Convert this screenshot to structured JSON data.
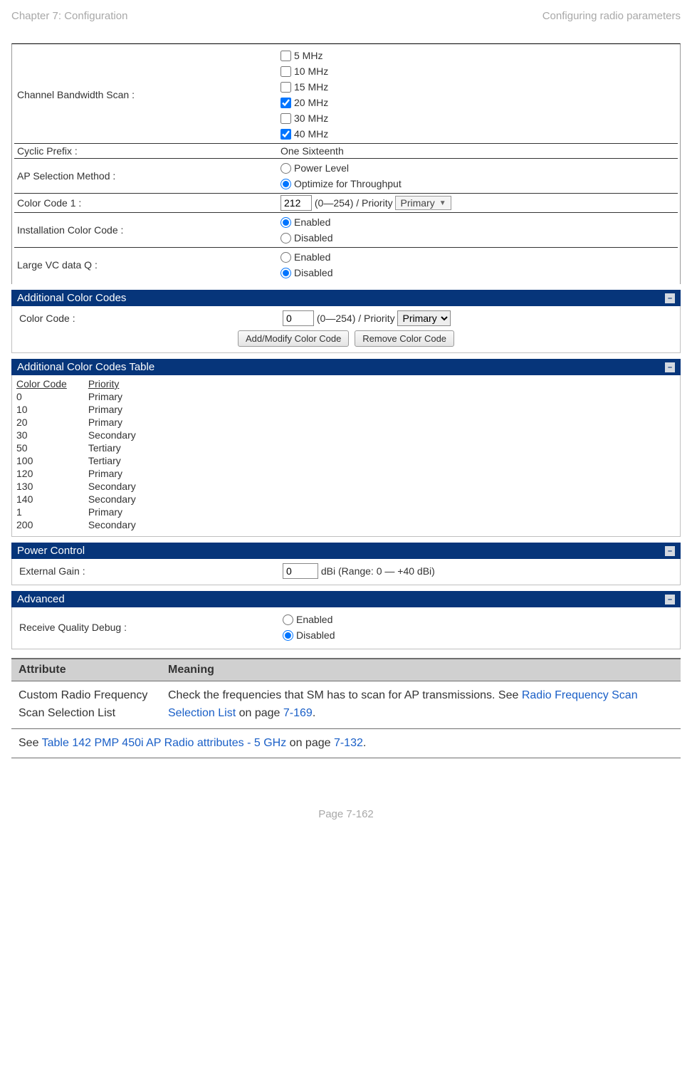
{
  "page": {
    "chapter": "Chapter 7:  Configuration",
    "section": "Configuring radio parameters",
    "footer": "Page 7-162"
  },
  "rows": {
    "channel_bw_label": "Channel Bandwidth Scan :",
    "channel_bw_opts": {
      "o0": "5 MHz",
      "o1": "10 MHz",
      "o2": "15 MHz",
      "o3": "20 MHz",
      "o4": "30 MHz",
      "o5": "40 MHz"
    },
    "cyclic_prefix_label": "Cyclic Prefix :",
    "cyclic_prefix_value": "One Sixteenth",
    "ap_sel_label": "AP Selection Method :",
    "ap_sel_opts": {
      "o0": "Power Level",
      "o1": "Optimize for Throughput"
    },
    "cc1_label": "Color Code 1 :",
    "cc1_value": "212",
    "cc1_range": "(0—254) / Priority",
    "cc1_priority": "Primary",
    "install_cc_label": "Installation Color Code :",
    "install_cc_opts": {
      "o0": "Enabled",
      "o1": "Disabled"
    },
    "large_vc_label": "Large VC data Q :",
    "large_vc_opts": {
      "o0": "Enabled",
      "o1": "Disabled"
    }
  },
  "additional_cc": {
    "header": "Additional Color Codes",
    "label": "Color Code :",
    "value": "0",
    "range": "(0—254) / Priority",
    "priority": "Primary",
    "btn_add": "Add/Modify Color Code",
    "btn_remove": "Remove Color Code"
  },
  "cc_table": {
    "header": "Additional Color Codes Table",
    "h_code": "Color Code",
    "h_priority": "Priority",
    "rows": {
      "r0": {
        "c": "0",
        "p": "Primary"
      },
      "r1": {
        "c": "10",
        "p": "Primary"
      },
      "r2": {
        "c": "20",
        "p": "Primary"
      },
      "r3": {
        "c": "30",
        "p": "Secondary"
      },
      "r4": {
        "c": "50",
        "p": "Tertiary"
      },
      "r5": {
        "c": "100",
        "p": "Tertiary"
      },
      "r6": {
        "c": "120",
        "p": "Primary"
      },
      "r7": {
        "c": "130",
        "p": "Secondary"
      },
      "r8": {
        "c": "140",
        "p": "Secondary"
      },
      "r9": {
        "c": "1",
        "p": "Primary"
      },
      "r10": {
        "c": "200",
        "p": "Secondary"
      }
    }
  },
  "power": {
    "header": "Power Control",
    "label": "External Gain :",
    "value": "0",
    "unit": "dBi (Range: 0 — +40 dBi)"
  },
  "advanced": {
    "header": "Advanced",
    "label": "Receive Quality Debug :",
    "opts": {
      "o0": "Enabled",
      "o1": "Disabled"
    }
  },
  "attr_table": {
    "h_attr": "Attribute",
    "h_mean": "Meaning",
    "r0_attr": "Custom Radio Frequency Scan Selection List",
    "r0_mean_a": "Check the frequencies that SM has to scan for AP transmissions. See ",
    "r0_mean_b": "Radio Frequency Scan Selection List",
    "r0_mean_c": " on page ",
    "r0_mean_d": "7-169",
    "r0_mean_e": ".",
    "r1_a": "See ",
    "r1_b": "Table 142 PMP 450i AP Radio attributes - 5 GHz ",
    "r1_c": " on page ",
    "r1_d": "7-132",
    "r1_e": "."
  }
}
